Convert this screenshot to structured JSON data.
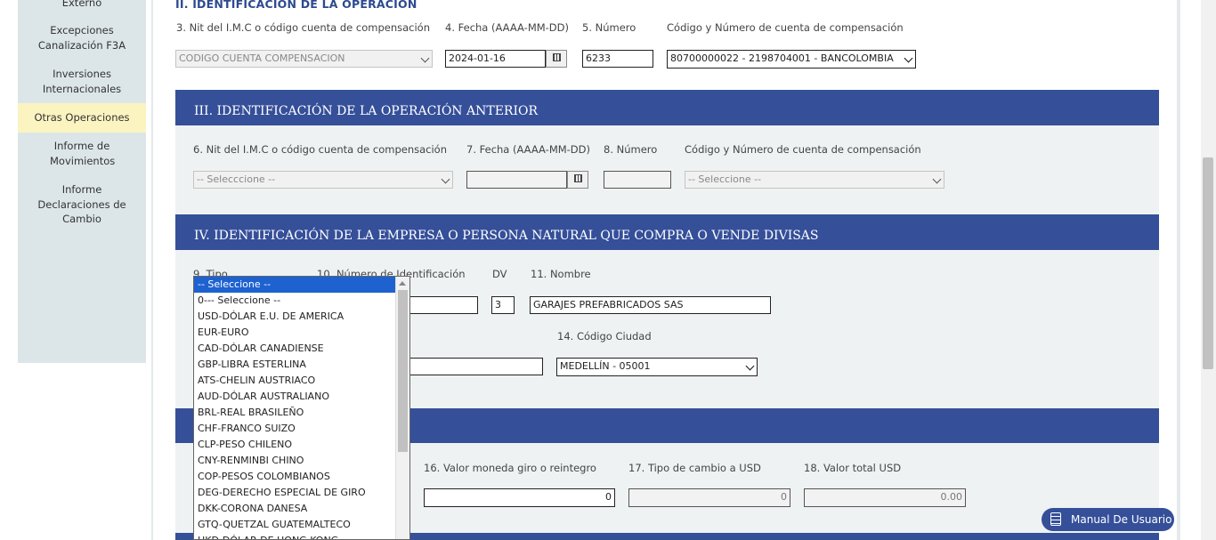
{
  "sidebar": {
    "items": [
      {
        "label": "Externo"
      },
      {
        "label": "Excepciones Canalización F3A"
      },
      {
        "label": "Inversiones Internacionales"
      },
      {
        "label": "Otras Operaciones",
        "active": true
      },
      {
        "label": "Informe de Movimientos"
      },
      {
        "label": "Informe Declaraciones de Cambio"
      }
    ]
  },
  "section2": {
    "title": "II. IDENTIFICACION DE LA OPERACION",
    "nit_label": "3. Nit del I.M.C o código cuenta de compensación",
    "nit_value": "CODIGO CUENTA COMPENSACION",
    "fecha_label": "4. Fecha (AAAA-MM-DD)",
    "fecha_value": "2024-01-16",
    "numero_label": "5. Número",
    "numero_value": "6233",
    "cuenta_label": "Código y Número de cuenta de compensación",
    "cuenta_value": "80700000022 - 2198704001 - BANCOLOMBIA"
  },
  "section3": {
    "title": "III. IDENTIFICACIÓN DE LA OPERACIÓN ANTERIOR",
    "nit_label": "6. Nit del I.M.C o código cuenta de compensación",
    "nit_value": "-- Selecccione --",
    "fecha_label": "7. Fecha (AAAA-MM-DD)",
    "fecha_value": "",
    "numero_label": "8. Número",
    "numero_value": "",
    "cuenta_label": "Código y Número de cuenta de compensación",
    "cuenta_value": "-- Seleccione --"
  },
  "section4": {
    "title": "IV. IDENTIFICACIÓN DE LA EMPRESA O PERSONA NATURAL QUE COMPRA O VENDE DIVISAS",
    "tipo_label": "9. Tipo",
    "idnum_label": "10. Número de Identificación",
    "dv_label": "DV",
    "dv_value": "3",
    "nombre_label": "11. Nombre",
    "nombre_value": "GARAJES PREFABRICADOS SAS",
    "ciudad_label": "14. Código Ciudad",
    "ciudad_value": "MEDELLÍN - 05001"
  },
  "section5": {
    "valor_giro_label": "16. Valor moneda giro o reintegro",
    "valor_giro_value": "0",
    "tipo_cambio_label": "17. Tipo de cambio a USD",
    "tipo_cambio_value": "0",
    "valor_usd_label": "18. Valor total USD",
    "valor_usd_value": "0.00"
  },
  "currency_dropdown": {
    "options": [
      "-- Seleccione --",
      "0--- Seleccione --",
      "USD-DÓLAR E.U. DE AMERICA",
      "EUR-EURO",
      "CAD-DÓLAR CANADIENSE",
      "GBP-LIBRA ESTERLINA",
      "ATS-CHELIN AUSTRIACO",
      "AUD-DÓLAR AUSTRALIANO",
      "BRL-REAL BRASILEÑO",
      "CHF-FRANCO SUIZO",
      "CLP-PESO CHILENO",
      "CNY-RENMINBI CHINO",
      "COP-PESOS COLOMBIANOS",
      "DEG-DERECHO ESPECIAL DE GIRO",
      "DKK-CORONA DANESA",
      "GTQ-QUETZAL GUATEMALTECO",
      "HKD-DÓLAR DE HONG KONG"
    ],
    "selected_index": 0
  },
  "manual_button": {
    "label": "Manual De Usuario",
    "icon": "book-icon"
  },
  "colors": {
    "accent": "#354f99",
    "panel": "#eef2f3",
    "sidebar": "#dce6e8",
    "active": "#fbf4c1",
    "selected": "#1e62d0"
  }
}
